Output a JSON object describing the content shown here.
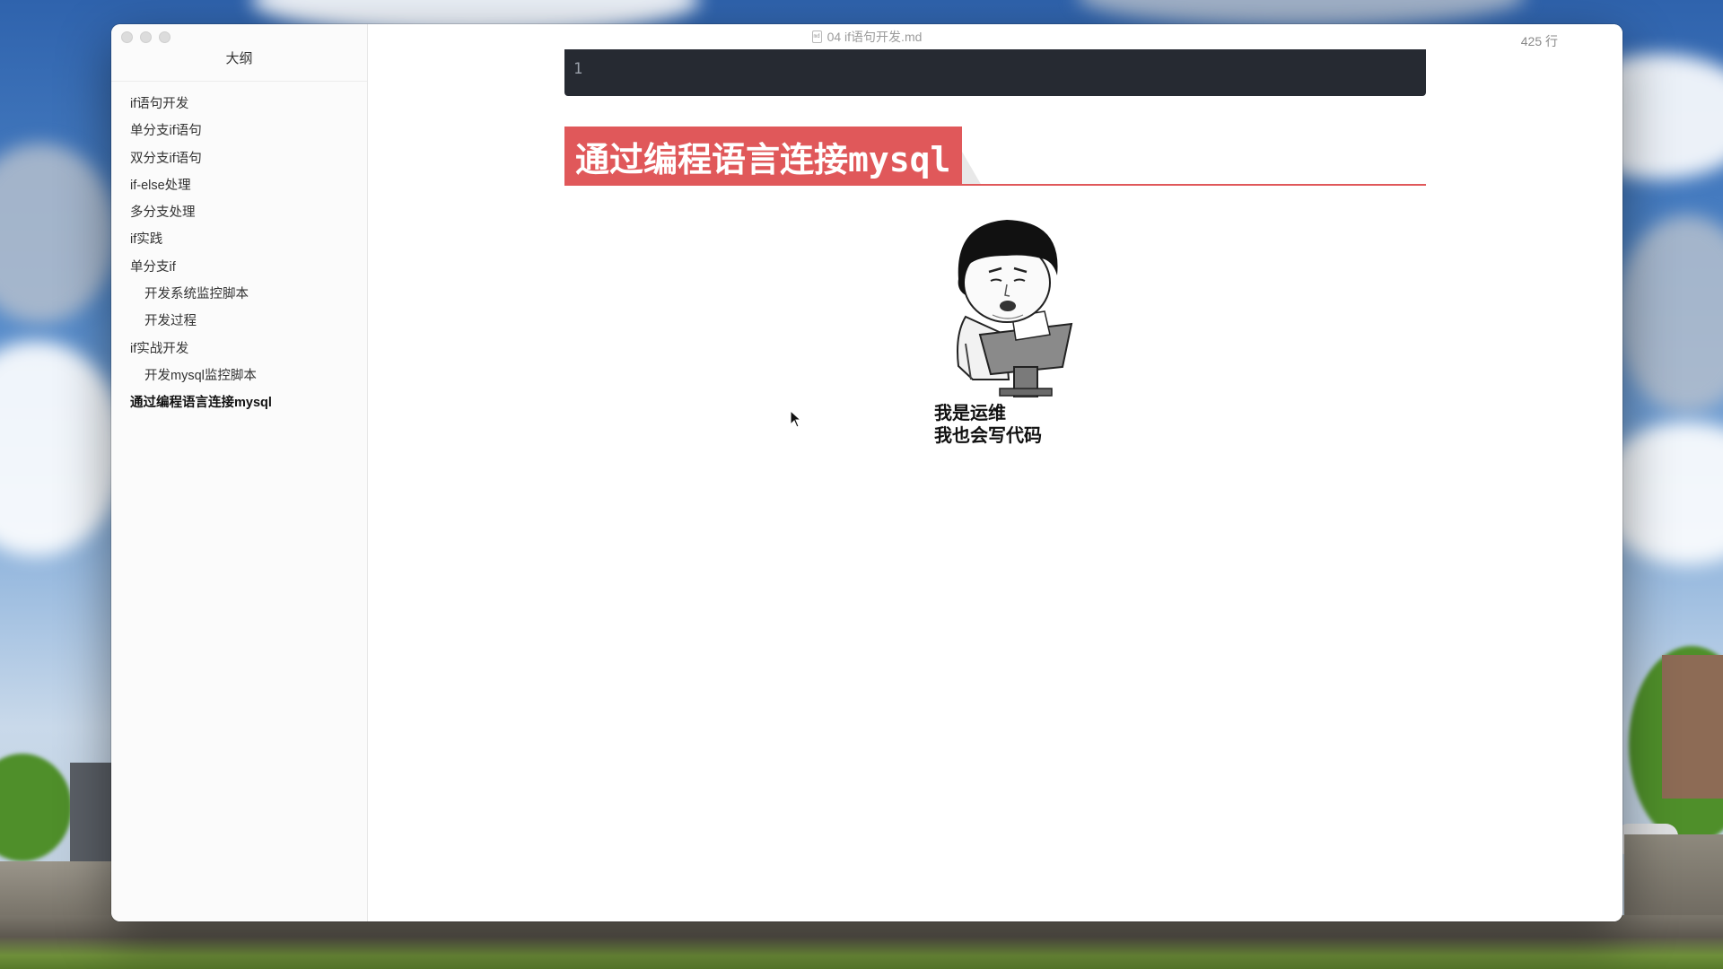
{
  "window": {
    "title": "04 if语句开发.md",
    "file_icon_label": "md",
    "line_count": "425 行"
  },
  "sidebar": {
    "header": "大纲",
    "items": [
      {
        "label": "if语句开发",
        "level": 1,
        "active": false
      },
      {
        "label": "单分支if语句",
        "level": 1,
        "active": false
      },
      {
        "label": "双分支if语句",
        "level": 1,
        "active": false
      },
      {
        "label": "if-else处理",
        "level": 1,
        "active": false
      },
      {
        "label": "多分支处理",
        "level": 1,
        "active": false
      },
      {
        "label": "if实践",
        "level": 1,
        "active": false
      },
      {
        "label": "单分支if",
        "level": 1,
        "active": false
      },
      {
        "label": "开发系统监控脚本",
        "level": 2,
        "active": false
      },
      {
        "label": "开发过程",
        "level": 2,
        "active": false
      },
      {
        "label": "if实战开发",
        "level": 1,
        "active": false
      },
      {
        "label": "开发mysql监控脚本",
        "level": 2,
        "active": false
      },
      {
        "label": "通过编程语言连接mysql",
        "level": 1,
        "active": true
      }
    ]
  },
  "editor": {
    "code_last_line": "1",
    "heading": "通过编程语言连接mysql",
    "meme_caption_line1": "我是运维",
    "meme_caption_line2": "我也会写代码"
  },
  "colors": {
    "heading_bg": "#e0585a",
    "code_bg": "#262a32",
    "window_bg": "#ffffff",
    "sidebar_bg": "#fbfbfb"
  }
}
